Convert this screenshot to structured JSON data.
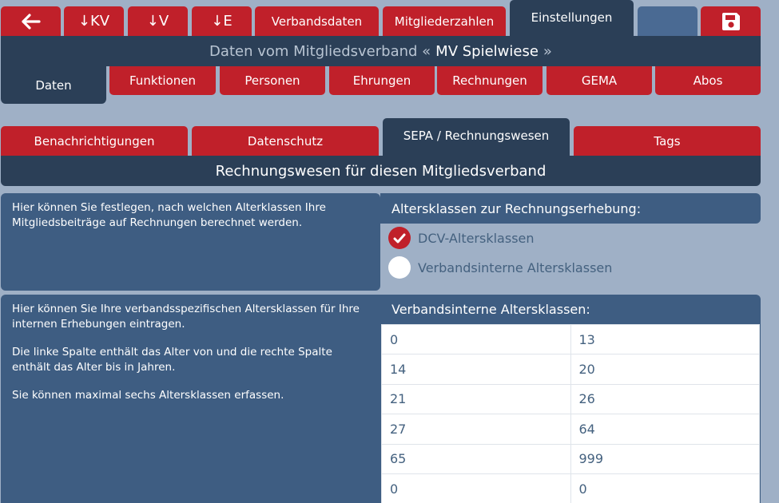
{
  "topbar": {
    "back_icon": "arrow-left-icon",
    "download_kv": "↓KV",
    "download_v": "↓V",
    "download_e": "↓E",
    "tab_verbandsdaten": "Verbandsdaten",
    "tab_mitgliederzahlen": "Mitgliederzahlen",
    "tab_einstellungen": "Einstellungen",
    "save_icon": "floppy-disk-icon"
  },
  "header": {
    "prefix": "Daten vom Mitgliedsverband «",
    "name": "MV Spielwiese",
    "suffix": "»"
  },
  "subtabs": {
    "daten": "Daten",
    "funktionen": "Funktionen",
    "personen": "Personen",
    "ehrungen": "Ehrungen",
    "rechnungen": "Rechnungen",
    "gema": "GEMA",
    "abos": "Abos"
  },
  "settingtabs": {
    "benachrichtigungen": "Benachrichtigungen",
    "datenschutz": "Datenschutz",
    "sepa": "SEPA / Rechnungswesen",
    "tags": "Tags"
  },
  "section_title": "Rechnungswesen für diesen Mitgliedsverband",
  "panel1": {
    "description": "Hier können Sie festlegen, nach welchen Alterklassen Ihre Mitgliedsbeiträge auf Rechnungen berechnet werden.",
    "heading": "Altersklassen zur Rechnungserhebung:",
    "option1": "DCV-Altersklassen",
    "option2": "Verbandsinterne Altersklassen",
    "selected": "DCV-Altersklassen"
  },
  "panel2": {
    "p1": "Hier können Sie Ihre verbandsspezifischen Altersklassen für Ihre internen Erhebungen eintragen.",
    "p2": "Die linke Spalte enthält das Alter von und die rechte Spalte enthält das Alter bis in Jahren.",
    "p3": "Sie können maximal sechs Altersklassen erfassen.",
    "heading": "Verbandsinterne Altersklassen:",
    "rows": [
      [
        "0",
        "13"
      ],
      [
        "14",
        "20"
      ],
      [
        "21",
        "26"
      ],
      [
        "27",
        "64"
      ],
      [
        "65",
        "999"
      ],
      [
        "0",
        "0"
      ]
    ]
  },
  "colors": {
    "background": "#9fb0c6",
    "red": "#c0202a",
    "navy": "#2b3f57",
    "panel_blue": "#3e5d82",
    "placeholder_button": "#4a6a93"
  }
}
